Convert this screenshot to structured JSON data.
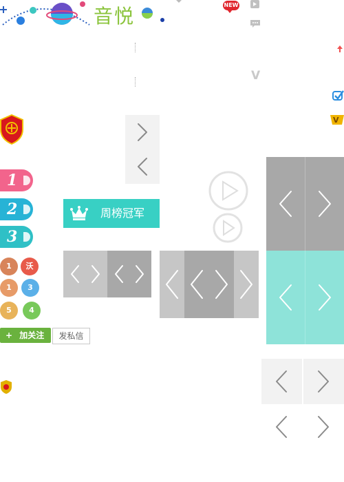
{
  "logo": {
    "text": "音悦"
  },
  "new_badge": "NEW",
  "weekly_button": {
    "label": "周榜冠军"
  },
  "rank_badges": [
    "1",
    "2",
    "3"
  ],
  "level_badges": [
    "1",
    "1",
    "3",
    "5",
    "4"
  ],
  "level_badge_char": "沃",
  "follow_button": {
    "label": "加关注",
    "plus": "+"
  },
  "message_button": {
    "label": "发私信"
  },
  "vip_letter": "V",
  "colors": {
    "teal": "#38d0c4",
    "pink": "#f2648c",
    "blue": "#27b3d6",
    "cyan": "#2fc0c6",
    "green": "#6ab23e",
    "gray_dark": "#a8a8a8",
    "gray_light": "#c6c6c6",
    "panel_teal": "#8ee3d9"
  }
}
